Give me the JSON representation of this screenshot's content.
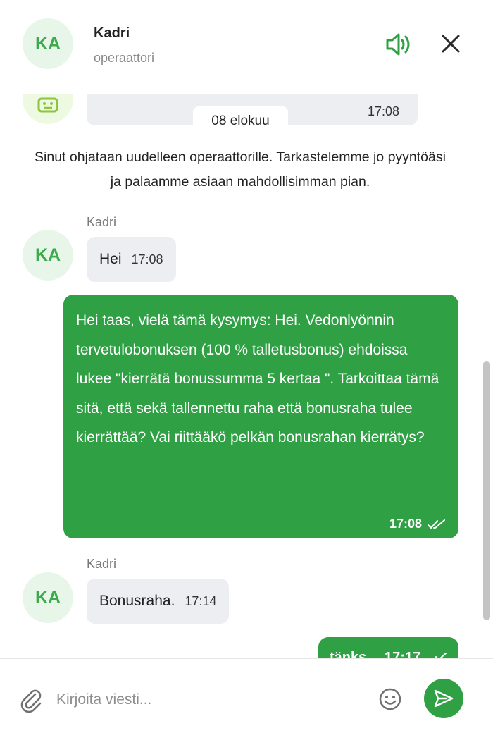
{
  "header": {
    "avatar_initials": "KA",
    "agent_name": "Kadri",
    "agent_role": "operaattori",
    "sound_icon": "speaker-on-icon",
    "close_icon": "close-icon"
  },
  "conversation": {
    "previous_bot_message_time": "17:08",
    "date_separator": "08 elokuu",
    "system_message": "Sinut ohjataan uudelleen operaattorille. Tarkastelemme jo pyyntöäsi ja palaamme asiaan mahdollisimman pian.",
    "messages": [
      {
        "direction": "in",
        "sender": "Kadri",
        "avatar": "KA",
        "text": "Hei",
        "time": "17:08"
      },
      {
        "direction": "out",
        "text": "Hei taas, vielä tämä kysymys: Hei. Vedonlyönnin tervetulobonuksen (100 % talletusbonus) ehdoissa lukee \"kierrätä bonussumma 5 kertaa \". Tarkoittaa tämä sitä, että sekä tallennettu raha että bonusraha tulee kierrättää? Vai riittääkö pelkän bonusrahan kierrätys?",
        "time": "17:08",
        "status": "read"
      },
      {
        "direction": "in",
        "sender": "Kadri",
        "avatar": "KA",
        "text": "Bonusraha.",
        "time": "17:14"
      },
      {
        "direction": "out",
        "text": "tänks",
        "time": "17:17",
        "status": "sent"
      }
    ]
  },
  "composer": {
    "placeholder": "Kirjoita viesti...",
    "value": "",
    "attach_icon": "paperclip-icon",
    "emoji_icon": "smiley-icon",
    "send_icon": "send-icon"
  },
  "colors": {
    "accent": "#2fa043",
    "avatar_bg": "#e8f6ea",
    "avatar_text": "#3bab4b",
    "bubble_in": "#eceef1"
  }
}
